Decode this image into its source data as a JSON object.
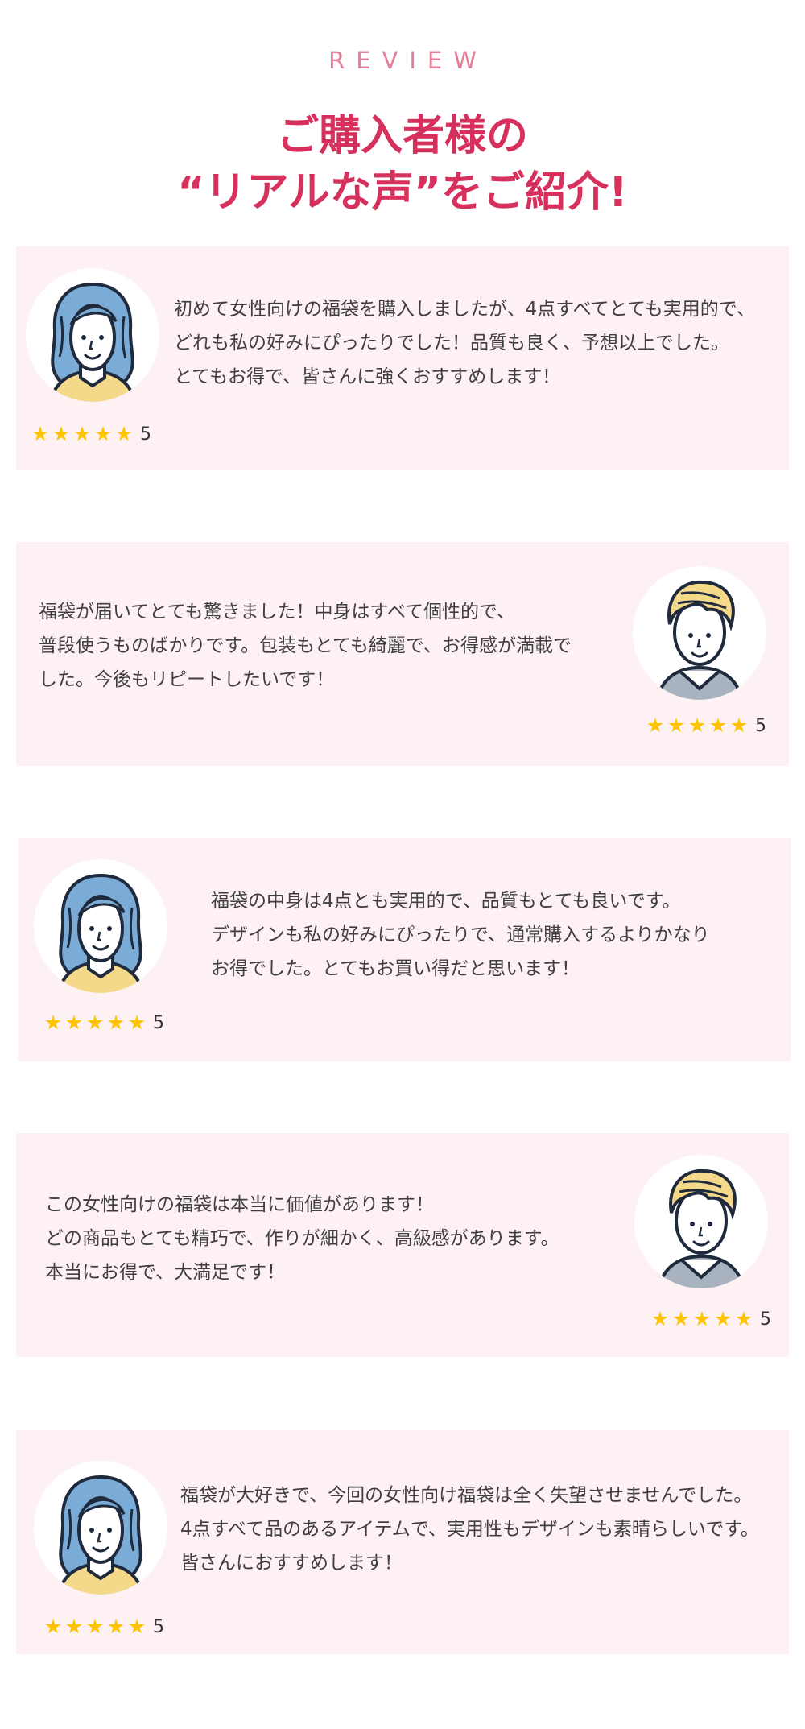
{
  "header": {
    "eyebrow": "REVIEW",
    "title_line1": "ご購入者様の",
    "title_line2": "“リアルな声”をご紹介!"
  },
  "colors": {
    "accent": "#d6315c",
    "eyebrow": "#e47f98",
    "card_background": "#fdf1f4",
    "star": "#ffc400"
  },
  "reviews": [
    {
      "avatar": "blue-hair-woman-icon",
      "lines": [
        "初めて女性向けの福袋を購入しましたが、4点すべてとても実用的で、",
        "どれも私の好みにぴったりでした！品質も良く、予想以上でした。",
        "とてもお得で、皆さんに強くおすすめします！"
      ],
      "stars": 5,
      "rating": "5"
    },
    {
      "avatar": "blonde-hair-person-icon",
      "lines": [
        "福袋が届いてとても驚きました！中身はすべて個性的で、",
        "普段使うものばかりです。包装もとても綺麗で、お得感が満載で",
        "した。今後もリピートしたいです！"
      ],
      "stars": 5,
      "rating": "5"
    },
    {
      "avatar": "blue-hair-woman-icon",
      "lines": [
        "福袋の中身は4点とも実用的で、品質もとても良いです。",
        "デザインも私の好みにぴったりで、通常購入するよりかなり",
        "お得でした。とてもお買い得だと思います！"
      ],
      "stars": 5,
      "rating": "5"
    },
    {
      "avatar": "blonde-hair-person-icon",
      "lines": [
        "この女性向けの福袋は本当に価値があります！",
        "どの商品もとても精巧で、作りが細かく、高級感があります。",
        "本当にお得で、大満足です！"
      ],
      "stars": 5,
      "rating": "5"
    },
    {
      "avatar": "blue-hair-woman-icon",
      "lines": [
        "福袋が大好きで、今回の女性向け福袋は全く失望させませんでした。",
        "4点すべて品のあるアイテムで、実用性もデザインも素晴らしいです。",
        "皆さんにおすすめします！"
      ],
      "stars": 5,
      "rating": "5"
    }
  ]
}
